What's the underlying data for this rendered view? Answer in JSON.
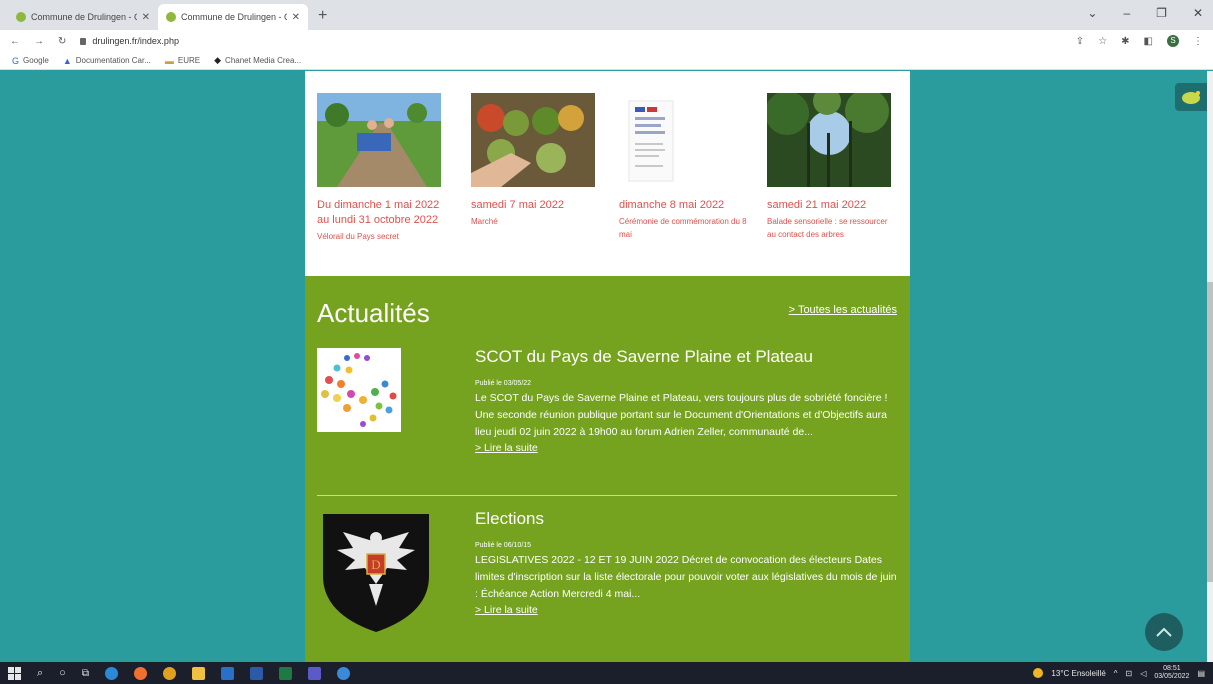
{
  "browser": {
    "tabs": [
      {
        "title": "Commune de Drulingen - Comm"
      },
      {
        "title": "Commune de Drulingen - Comm"
      }
    ],
    "new_tab_label": "+",
    "url": "drulingen.fr/index.php",
    "bookmarks": [
      {
        "label": "Google"
      },
      {
        "label": "Documentation Car..."
      },
      {
        "label": "EURE"
      },
      {
        "label": "Chanet Media Crea..."
      }
    ]
  },
  "events": [
    {
      "date": "Du dimanche 1 mai 2022 au lundi 31 octobre 2022",
      "name": "Vélorail du Pays secret",
      "image": "velorail-photo"
    },
    {
      "date": "samedi 7 mai 2022",
      "name": "Marché",
      "image": "market-photo"
    },
    {
      "date": "dimanche 8 mai 2022",
      "name": "Cérémonie de commémoration du 8 mai",
      "image": "poster-document"
    },
    {
      "date": "samedi 21 mai 2022",
      "name": "Balade sensorielle : se ressourcer au contact des arbres",
      "image": "forest-photo"
    }
  ],
  "news": {
    "heading": "Actualités",
    "all_link": "> Toutes les actualités",
    "articles": [
      {
        "title": "SCOT du Pays de Saverne Plaine et Plateau",
        "published": "Publié le 03/05/22",
        "excerpt": "Le SCOT du Pays de Saverne Plaine et Plateau, vers toujours plus de sobriété foncière ! Une seconde réunion publique portant sur le Document d'Orientations et d'Objectifs aura lieu jeudi 02 juin 2022 à 19h00 au forum Adrien Zeller, communauté de...",
        "more": "> Lire la suite"
      },
      {
        "title": "Elections",
        "published": "Publié le 06/10/15",
        "excerpt": "LEGISLATIVES 2022 - 12 ET 19 JUIN 2022 Décret de convocation des électeurs Dates limites d'inscription sur la liste électorale pour pouvoir voter aux législatives du mois de juin : Échéance Action Mercredi 4 mai...",
        "more": "> Lire la suite"
      }
    ]
  },
  "taskbar": {
    "weather": "13°C Ensoleillé",
    "time": "08:51",
    "date": "03/05/2022"
  },
  "colors": {
    "page_bg": "#2a9c9e",
    "news_bg": "#76a31f",
    "event_red": "#d9534f"
  }
}
